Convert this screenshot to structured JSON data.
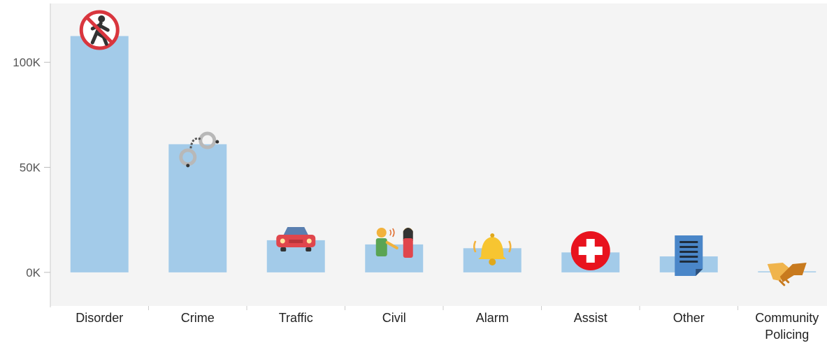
{
  "chart_data": {
    "type": "bar",
    "title": "",
    "xlabel": "",
    "ylabel": "",
    "ylim": [
      -16000,
      128000
    ],
    "yticks": [
      {
        "value": 0,
        "label": "0K"
      },
      {
        "value": 50000,
        "label": "50K"
      },
      {
        "value": 100000,
        "label": "100K"
      }
    ],
    "categories": [
      {
        "lines": [
          "Disorder"
        ]
      },
      {
        "lines": [
          "Crime"
        ]
      },
      {
        "lines": [
          "Traffic"
        ]
      },
      {
        "lines": [
          "Civil"
        ]
      },
      {
        "lines": [
          "Alarm"
        ]
      },
      {
        "lines": [
          "Assist"
        ]
      },
      {
        "lines": [
          "Other"
        ]
      },
      {
        "lines": [
          "Community",
          "Policing"
        ]
      }
    ],
    "values": [
      112500,
      61000,
      15300,
      13300,
      11500,
      9500,
      7600,
      500
    ],
    "icons": [
      "no-pedestrian-icon",
      "handcuffs-icon",
      "car-icon",
      "people-talking-icon",
      "bell-icon",
      "medical-cross-icon",
      "document-icon",
      "handshake-icon"
    ],
    "bar_color": "#a3cbe9",
    "background_color": "#f4f4f4",
    "grid": false
  }
}
